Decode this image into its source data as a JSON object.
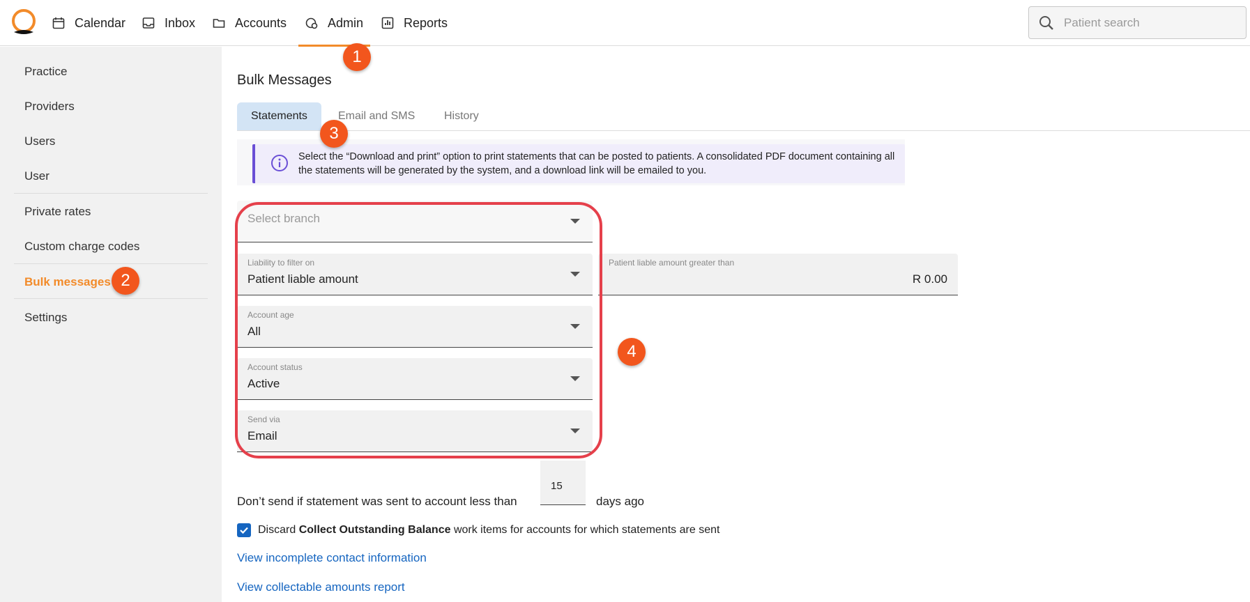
{
  "nav": {
    "items": [
      {
        "label": "Calendar",
        "icon": "calendar-icon"
      },
      {
        "label": "Inbox",
        "icon": "inbox-icon"
      },
      {
        "label": "Accounts",
        "icon": "folder-icon"
      },
      {
        "label": "Admin",
        "icon": "admin-icon",
        "active": true
      },
      {
        "label": "Reports",
        "icon": "reports-icon"
      }
    ],
    "search_placeholder": "Patient search"
  },
  "sidebar": {
    "items": [
      {
        "label": "Practice"
      },
      {
        "label": "Providers"
      },
      {
        "label": "Users"
      },
      {
        "label": "User"
      },
      {
        "label": "Private rates"
      },
      {
        "label": "Custom charge codes"
      },
      {
        "label": "Bulk messages",
        "active": true
      },
      {
        "label": "Settings"
      }
    ]
  },
  "main": {
    "title": "Bulk Messages",
    "tabs": [
      {
        "label": "Statements",
        "active": true
      },
      {
        "label": "Email and SMS"
      },
      {
        "label": "History"
      }
    ],
    "info_text": "Select the “Download and print” option to print statements that can be posted to patients. A consolidated PDF document containing all the statements will be generated by the system, and a download link will be emailed to you.",
    "fields": {
      "branch": {
        "placeholder": "Select branch"
      },
      "liability": {
        "label": "Liability to filter on",
        "value": "Patient liable amount"
      },
      "amount": {
        "label": "Patient liable amount greater than",
        "value": "R 0.00"
      },
      "account_age": {
        "label": "Account age",
        "value": "All"
      },
      "account_status": {
        "label": "Account status",
        "value": "Active"
      },
      "send_via": {
        "label": "Send via",
        "value": "Email"
      }
    },
    "days": {
      "prefix": "Don’t send if statement was sent to account less than",
      "value": "15",
      "suffix": "days ago"
    },
    "discard": {
      "checked": true,
      "text_before": "Discard ",
      "text_bold": "Collect Outstanding Balance",
      "text_after": " work items for accounts for which statements are sent"
    },
    "links": {
      "incomplete": "View incomplete contact information",
      "collectable": "View collectable amounts report"
    }
  },
  "annotations": [
    "1",
    "2",
    "3",
    "4"
  ],
  "colors": {
    "accent": "#f28b2a",
    "link": "#1565c0",
    "badge": "#f2561d",
    "highlight": "#e5404b",
    "tab_active": "#d3e4f5"
  }
}
